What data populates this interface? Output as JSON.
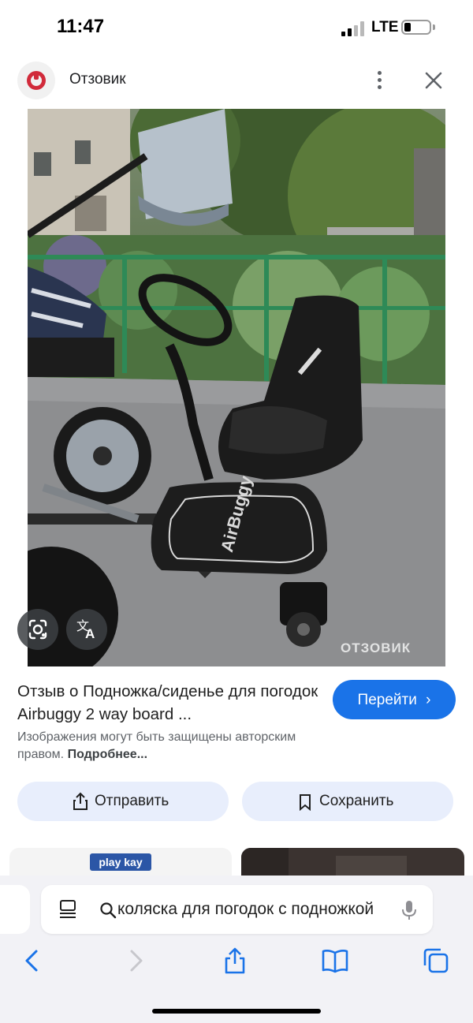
{
  "status_bar": {
    "time": "11:47",
    "network": "LTE"
  },
  "header": {
    "site_name": "Отзовик",
    "brand_color": "#d12a3a"
  },
  "image": {
    "watermark": "ОТЗОВИК",
    "board_brand": "AirBuggy",
    "lens_icon": "lens-camera-icon",
    "translate_icon": "translate-icon"
  },
  "result": {
    "title": "Отзыв о Подножка/сиденье для погодок Airbuggy 2 way board ...",
    "visit_label": "Перейти",
    "copyright_text": "Изображения могут быть защищены авторским правом.",
    "more_link": "Подробнее...",
    "share_label": "Отправить",
    "save_label": "Сохранить"
  },
  "related": {
    "left_logo": "play kay"
  },
  "browser": {
    "address_text": "коляска для погодок с подножкой",
    "accent_color": "#1a73e8",
    "icons": [
      "reader-icon",
      "search-icon",
      "microphone-icon",
      "back-icon",
      "forward-icon",
      "share-icon",
      "bookmarks-icon",
      "tabs-icon"
    ]
  }
}
